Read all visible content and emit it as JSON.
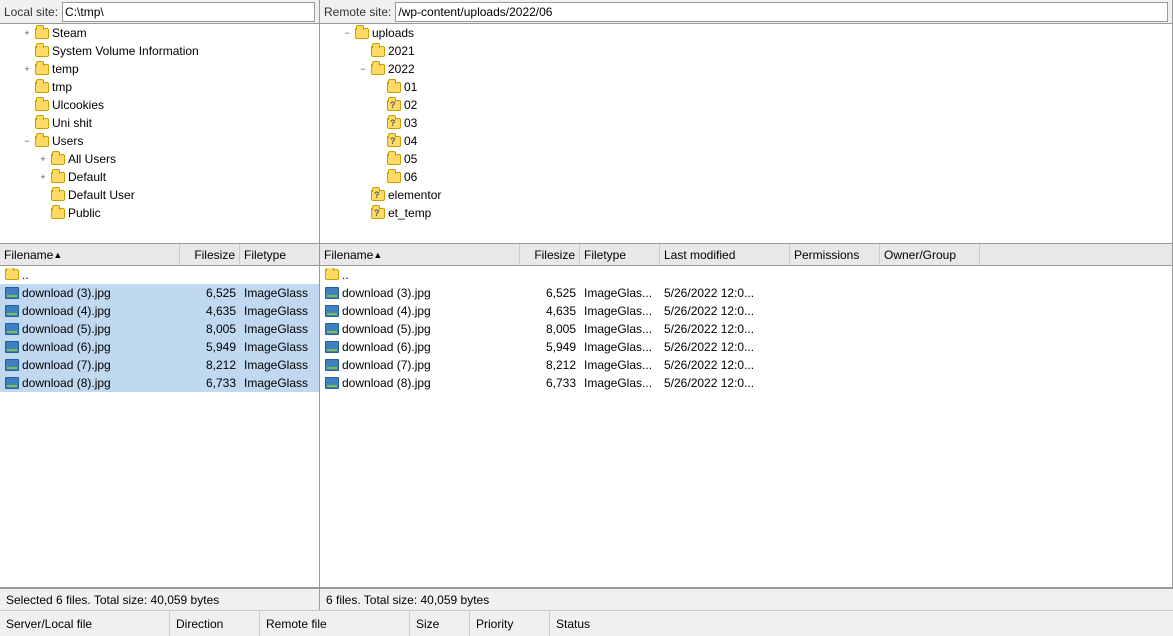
{
  "localSite": {
    "label": "Local site:",
    "path": "C:\\tmp\\"
  },
  "remoteSite": {
    "label": "Remote site:",
    "path": "/wp-content/uploads/2022/06"
  },
  "localTree": {
    "items": [
      {
        "indent": 1,
        "expander": "+",
        "type": "folder",
        "name": "Steam"
      },
      {
        "indent": 1,
        "expander": "",
        "type": "folder",
        "name": "System Volume Information"
      },
      {
        "indent": 1,
        "expander": "+",
        "type": "folder",
        "name": "temp"
      },
      {
        "indent": 1,
        "expander": "",
        "type": "folder",
        "name": "tmp"
      },
      {
        "indent": 1,
        "expander": "",
        "type": "folder",
        "name": "Ulcookies"
      },
      {
        "indent": 1,
        "expander": "",
        "type": "folder",
        "name": "Uni shit"
      },
      {
        "indent": 1,
        "expander": "-",
        "type": "folder",
        "name": "Users"
      },
      {
        "indent": 2,
        "expander": "+",
        "type": "folder",
        "name": "All Users"
      },
      {
        "indent": 2,
        "expander": "+",
        "type": "folder",
        "name": "Default"
      },
      {
        "indent": 2,
        "expander": "",
        "type": "folder",
        "name": "Default User"
      },
      {
        "indent": 2,
        "expander": "",
        "type": "folder",
        "name": "Public"
      }
    ]
  },
  "remoteTree": {
    "items": [
      {
        "indent": 1,
        "expander": "-",
        "type": "folder",
        "name": "uploads"
      },
      {
        "indent": 2,
        "expander": "",
        "type": "folder",
        "name": "2021"
      },
      {
        "indent": 2,
        "expander": "-",
        "type": "folder",
        "name": "2022"
      },
      {
        "indent": 3,
        "expander": "",
        "type": "folder",
        "name": "01"
      },
      {
        "indent": 3,
        "expander": "",
        "type": "folder-q",
        "name": "02"
      },
      {
        "indent": 3,
        "expander": "",
        "type": "folder-q",
        "name": "03"
      },
      {
        "indent": 3,
        "expander": "",
        "type": "folder-q",
        "name": "04"
      },
      {
        "indent": 3,
        "expander": "",
        "type": "folder",
        "name": "05"
      },
      {
        "indent": 3,
        "expander": "",
        "type": "folder",
        "name": "06"
      },
      {
        "indent": 2,
        "expander": "",
        "type": "folder-q",
        "name": "elementor"
      },
      {
        "indent": 2,
        "expander": "",
        "type": "folder-q",
        "name": "et_temp"
      }
    ]
  },
  "localFileList": {
    "headers": [
      {
        "key": "filename",
        "label": "Filename",
        "sort": "asc"
      },
      {
        "key": "filesize",
        "label": "Filesize"
      },
      {
        "key": "filetype",
        "label": "Filetype"
      }
    ],
    "files": [
      {
        "name": "..",
        "size": "",
        "type": "",
        "isParent": true
      },
      {
        "name": "download (3).jpg",
        "size": "6,525",
        "type": "ImageGlass",
        "selected": true
      },
      {
        "name": "download (4).jpg",
        "size": "4,635",
        "type": "ImageGlass",
        "selected": true
      },
      {
        "name": "download (5).jpg",
        "size": "8,005",
        "type": "ImageGlass",
        "selected": true
      },
      {
        "name": "download (6).jpg",
        "size": "5,949",
        "type": "ImageGlass",
        "selected": true
      },
      {
        "name": "download (7).jpg",
        "size": "8,212",
        "type": "ImageGlass",
        "selected": true
      },
      {
        "name": "download (8).jpg",
        "size": "6,733",
        "type": "ImageGlass",
        "selected": true
      }
    ],
    "status": "Selected 6 files. Total size: 40,059 bytes"
  },
  "remoteFileList": {
    "headers": [
      {
        "key": "filename",
        "label": "Filename",
        "sort": "asc"
      },
      {
        "key": "filesize",
        "label": "Filesize"
      },
      {
        "key": "filetype",
        "label": "Filetype"
      },
      {
        "key": "lastmod",
        "label": "Last modified"
      },
      {
        "key": "perms",
        "label": "Permissions"
      },
      {
        "key": "owner",
        "label": "Owner/Group"
      }
    ],
    "files": [
      {
        "name": "..",
        "size": "",
        "type": "",
        "lastmod": "",
        "perms": "",
        "owner": "",
        "isParent": true
      },
      {
        "name": "download (3).jpg",
        "size": "6,525",
        "type": "ImageGlas...",
        "lastmod": "5/26/2022 12:0...",
        "perms": "",
        "owner": ""
      },
      {
        "name": "download (4).jpg",
        "size": "4,635",
        "type": "ImageGlas...",
        "lastmod": "5/26/2022 12:0...",
        "perms": "",
        "owner": ""
      },
      {
        "name": "download (5).jpg",
        "size": "8,005",
        "type": "ImageGlas...",
        "lastmod": "5/26/2022 12:0...",
        "perms": "",
        "owner": ""
      },
      {
        "name": "download (6).jpg",
        "size": "5,949",
        "type": "ImageGlas...",
        "lastmod": "5/26/2022 12:0...",
        "perms": "",
        "owner": ""
      },
      {
        "name": "download (7).jpg",
        "size": "8,212",
        "type": "ImageGlas...",
        "lastmod": "5/26/2022 12:0...",
        "perms": "",
        "owner": ""
      },
      {
        "name": "download (8).jpg",
        "size": "6,733",
        "type": "ImageGlas...",
        "lastmod": "5/26/2022 12:0...",
        "perms": "",
        "owner": ""
      }
    ],
    "status": "6 files. Total size: 40,059 bytes"
  },
  "queueBar": {
    "col1": "Server/Local file",
    "col2": "Direction",
    "col3": "Remote file",
    "col4": "Size",
    "col5": "Priority",
    "col6": "Status"
  }
}
